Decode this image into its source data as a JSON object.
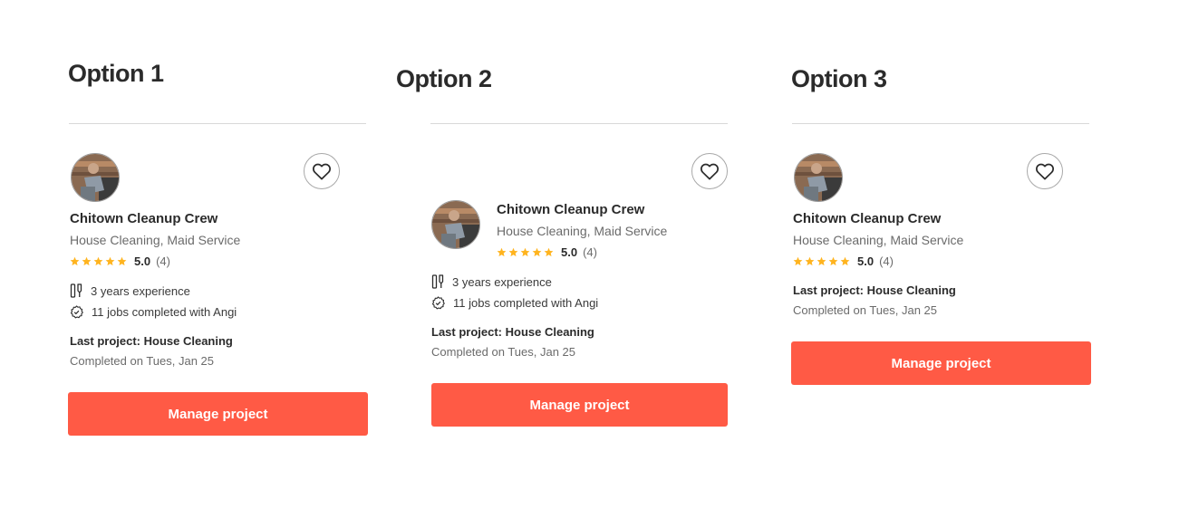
{
  "options": [
    {
      "title": "Option 1",
      "pro_name": "Chitown Cleanup Crew",
      "categories": "House Cleaning, Maid Service",
      "rating": "5.0",
      "review_count": "(4)",
      "stars": 5,
      "experience": "3 years experience",
      "jobs": "11 jobs completed with Angi",
      "last_project": "Last project: House Cleaning",
      "completed": "Completed on Tues, Jan 25",
      "button": "Manage project"
    },
    {
      "title": "Option 2",
      "pro_name": "Chitown Cleanup Crew",
      "categories": "House Cleaning, Maid Service",
      "rating": "5.0",
      "review_count": "(4)",
      "stars": 5,
      "experience": "3 years experience",
      "jobs": "11 jobs completed with Angi",
      "last_project": "Last project: House Cleaning",
      "completed": "Completed on Tues, Jan 25",
      "button": "Manage project"
    },
    {
      "title": "Option 3",
      "pro_name": "Chitown Cleanup Crew",
      "categories": "House Cleaning, Maid Service",
      "rating": "5.0",
      "review_count": "(4)",
      "stars": 5,
      "last_project": "Last project: House Cleaning",
      "completed": "Completed on Tues, Jan 25",
      "button": "Manage project"
    }
  ],
  "icons": {
    "favorite": "heart-icon",
    "experience": "tools-icon",
    "jobs": "verified-badge-icon",
    "star": "star-icon"
  },
  "colors": {
    "accent": "#ff5a45",
    "star": "#ffb41f",
    "divider": "#d8d8d8"
  }
}
